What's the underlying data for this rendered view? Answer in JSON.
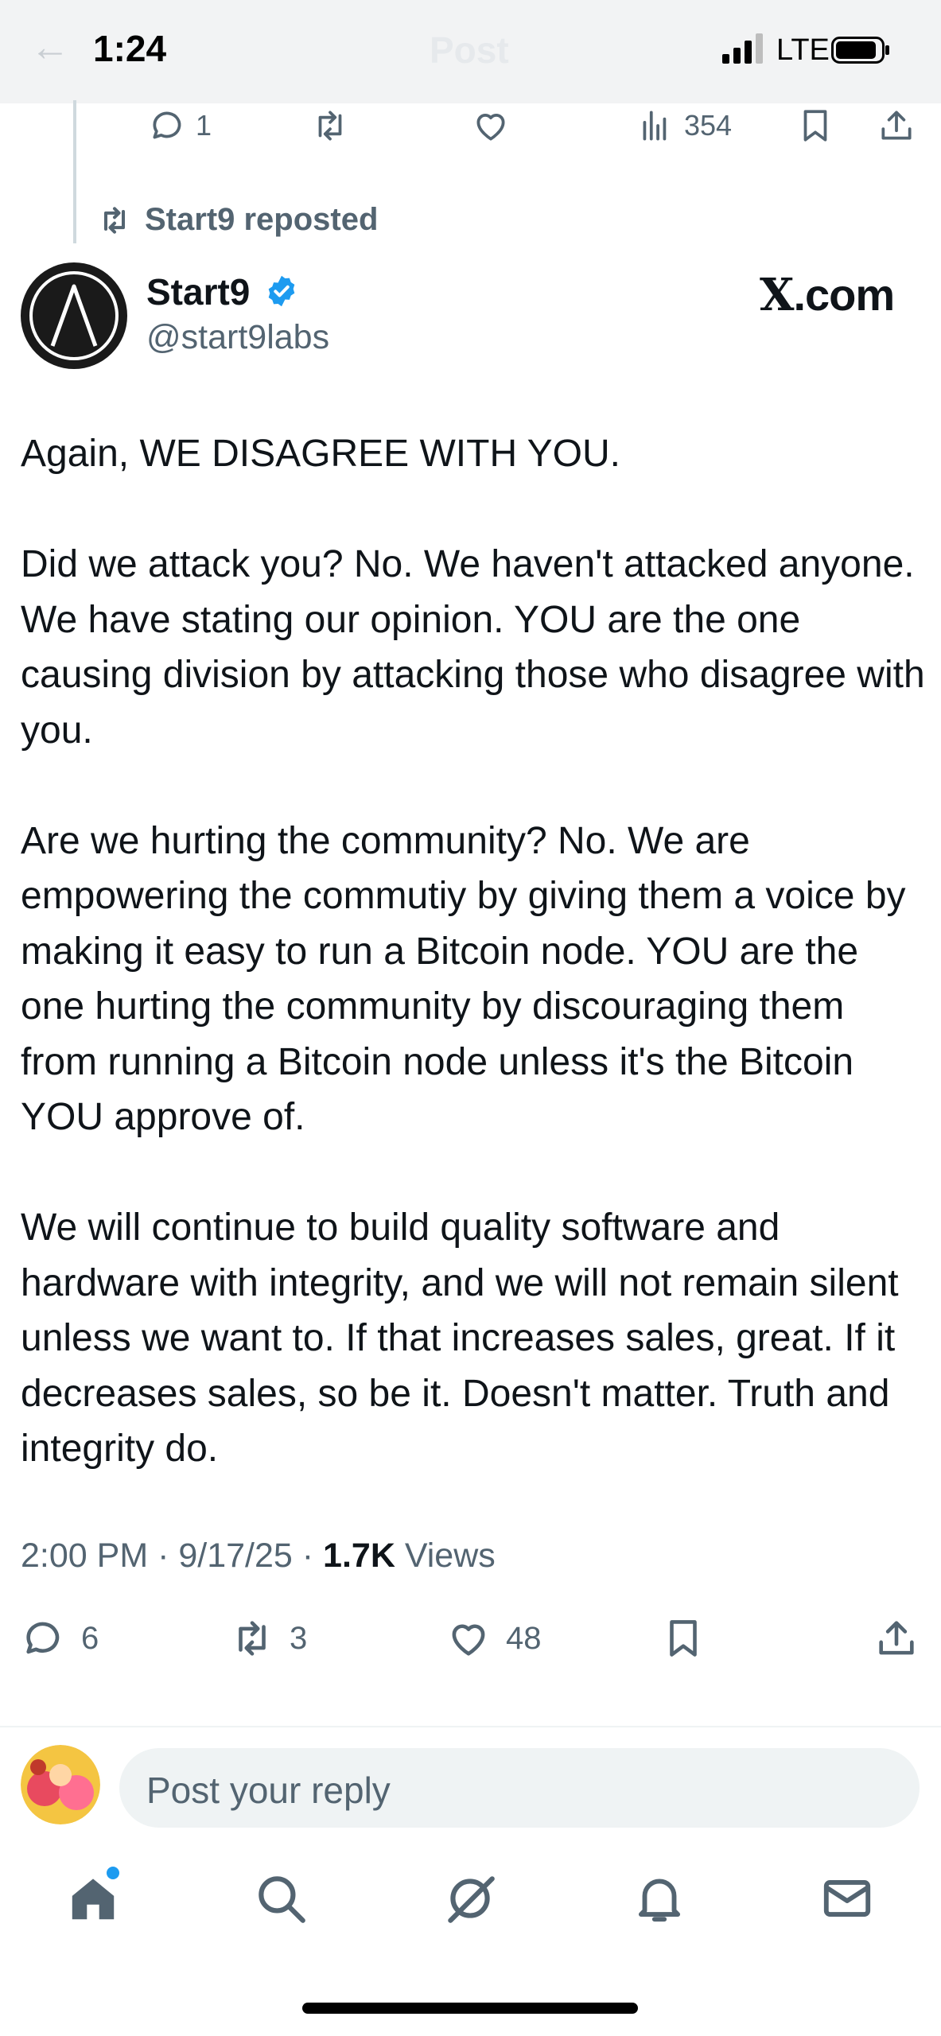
{
  "status_bar": {
    "time": "1:24",
    "network": "LTE"
  },
  "header": {
    "title": "Post"
  },
  "previous_post": {
    "replies": "1",
    "views": "354"
  },
  "repost_banner": {
    "text": "Start9 reposted"
  },
  "author": {
    "name": "Start9",
    "handle": "@start9labs",
    "verified": true
  },
  "watermark": {
    "prefix": "X",
    "suffix": ".com"
  },
  "post": {
    "paragraphs": [
      "Again, WE DISAGREE WITH YOU.",
      "Did we attack you? No. We haven't attacked anyone. We have stating our opinion. YOU are the one causing division by attacking those who disagree with you.",
      "Are we hurting the community? No. We are empowering the commutiy by giving them a voice by making it easy to run a Bitcoin node. YOU are the one hurting the community by discouraging them from running a Bitcoin node unless it's the Bitcoin YOU approve of.",
      "We will continue to build quality software and hardware with integrity, and we will not remain silent unless we want to. If that increases sales, great. If it decreases sales, so be it. Doesn't matter. Truth and integrity do."
    ],
    "time": "2:00 PM",
    "date": "9/17/25",
    "views_count": "1.7K",
    "views_label": "Views",
    "replies": "6",
    "reposts": "3",
    "likes": "48"
  },
  "reply_composer": {
    "placeholder": "Post your reply"
  },
  "colors": {
    "accent": "#1d9bf0",
    "text": "#0f1419",
    "muted": "#536471"
  }
}
